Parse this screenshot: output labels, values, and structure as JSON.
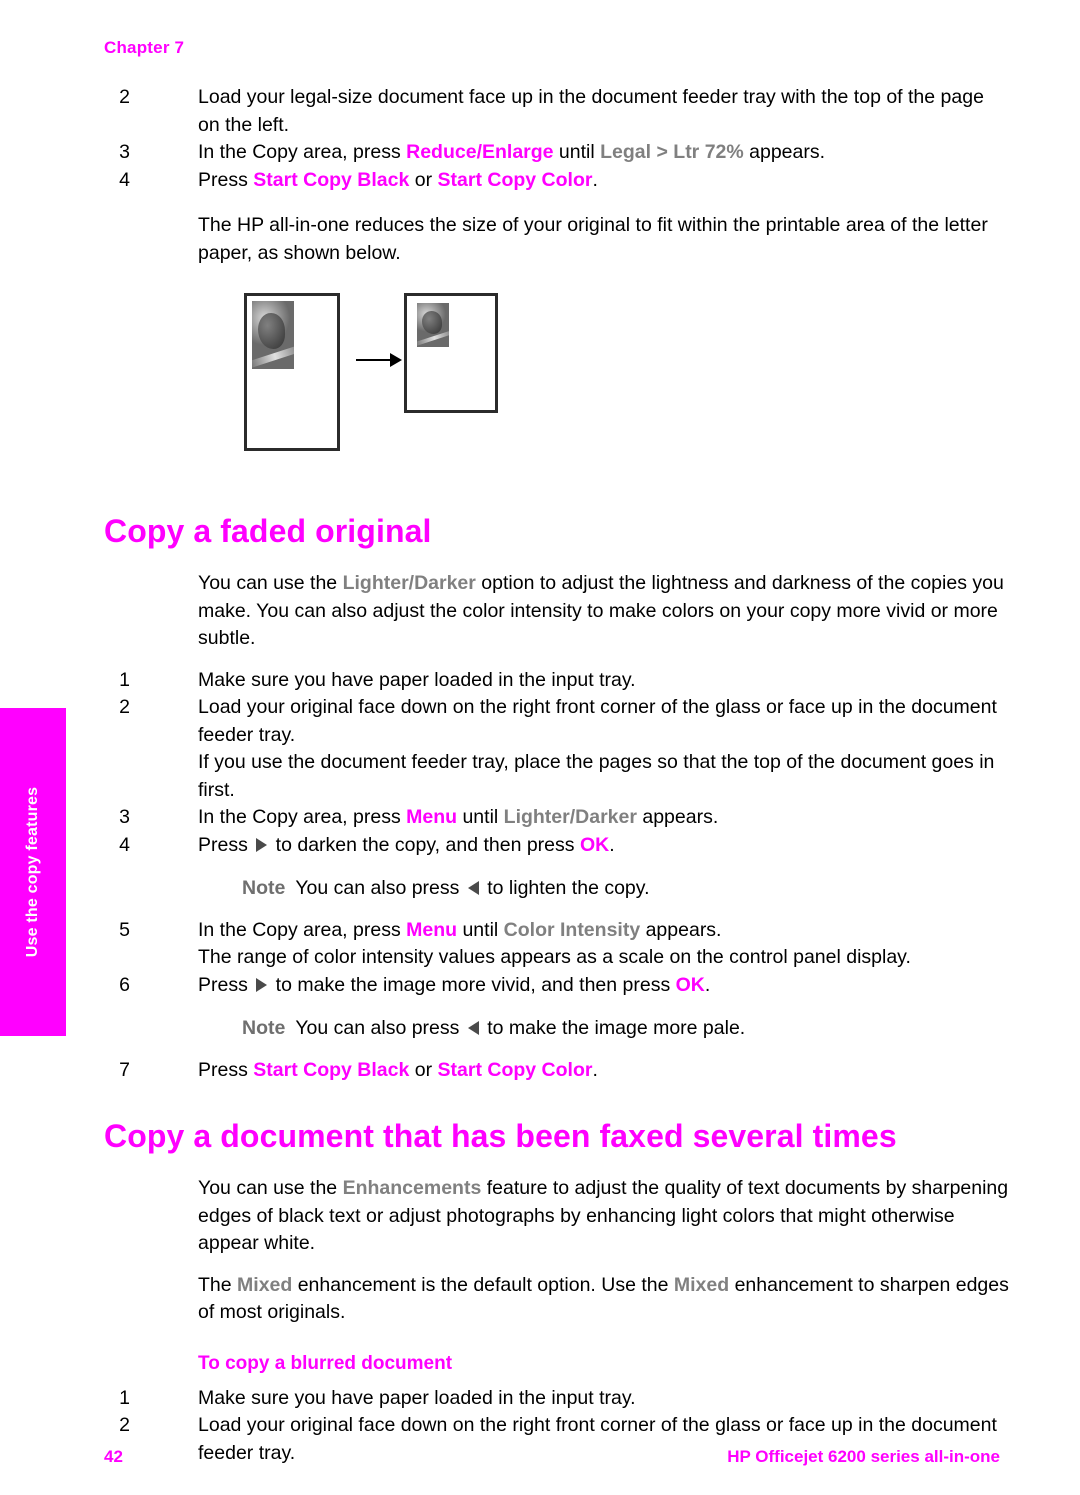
{
  "chapter_label": "Chapter 7",
  "side_tab": {
    "label": "Use the copy features",
    "background": "#ff00ff",
    "text_color": "#ffffff"
  },
  "colors": {
    "accent_magenta": "#ff00ff",
    "ui_term_gray": "#808080",
    "note_gray": "#6f6f6f",
    "body_black": "#000000"
  },
  "top_steps": {
    "step2": {
      "num": "2",
      "text": "Load your legal-size document face up in the document feeder tray with the top of the page on the left."
    },
    "step3": {
      "num": "3",
      "pre": "In the Copy area, press ",
      "button": "Reduce/Enlarge",
      "mid": " until ",
      "ui": "Legal > Ltr 72%",
      "post": " appears."
    },
    "step4": {
      "num": "4",
      "pre": "Press ",
      "button_black": "Start Copy Black",
      "mid": " or ",
      "button_color": "Start Copy Color",
      "post": "."
    }
  },
  "result_paragraph": "The HP all-in-one reduces the size of your original to fit within the printable area of the letter paper, as shown below.",
  "figure": {
    "name": "legal-to-letter-reduction-illustration",
    "source_page_alt": "Legal-size original page with photo and text",
    "result_page_alt": "Letter-size reduced copy with photo and text",
    "arrow_alt": "reduces to"
  },
  "section1": {
    "heading": "Copy a faded original",
    "intro": {
      "pre": "You can use the ",
      "ui": "Lighter/Darker",
      "post": " option to adjust the lightness and darkness of the copies you make. You can also adjust the color intensity to make colors on your copy more vivid or more subtle."
    },
    "steps": {
      "s1": {
        "num": "1",
        "text": "Make sure you have paper loaded in the input tray."
      },
      "s2": {
        "num": "2",
        "text": "Load your original face down on the right front corner of the glass or face up in the document feeder tray.",
        "extra": "If you use the document feeder tray, place the pages so that the top of the document goes in first."
      },
      "s3": {
        "num": "3",
        "pre": "In the Copy area, press ",
        "button": "Menu",
        "mid": " until ",
        "ui": "Lighter/Darker",
        "post": " appears."
      },
      "s4": {
        "num": "4",
        "pre": "Press ",
        "mid": " to darken the copy, and then press ",
        "button": "OK",
        "post": "."
      },
      "note1": {
        "label": "Note",
        "pre": "You can also press ",
        "post": " to lighten the copy."
      },
      "s5": {
        "num": "5",
        "pre": "In the Copy area, press ",
        "button": "Menu",
        "mid": " until ",
        "ui": "Color Intensity",
        "post": " appears.",
        "extra": "The range of color intensity values appears as a scale on the control panel display."
      },
      "s6": {
        "num": "6",
        "pre": "Press ",
        "mid": " to make the image more vivid, and then press ",
        "button": "OK",
        "post": "."
      },
      "note2": {
        "label": "Note",
        "pre": "You can also press ",
        "post": " to make the image more pale."
      },
      "s7": {
        "num": "7",
        "pre": "Press ",
        "button_black": "Start Copy Black",
        "mid": " or ",
        "button_color": "Start Copy Color",
        "post": "."
      }
    }
  },
  "section2": {
    "heading": "Copy a document that has been faxed several times",
    "intro": {
      "pre": "You can use the ",
      "ui": "Enhancements",
      "post": " feature to adjust the quality of text documents by sharpening edges of black text or adjust photographs by enhancing light colors that might otherwise appear white."
    },
    "default_note": {
      "pre": "The ",
      "ui1": "Mixed",
      "mid": " enhancement is the default option. Use the ",
      "ui2": "Mixed",
      "post": " enhancement to sharpen edges of most originals."
    },
    "subheading": "To copy a blurred document",
    "steps": {
      "s1": {
        "num": "1",
        "text": "Make sure you have paper loaded in the input tray."
      },
      "s2": {
        "num": "2",
        "text": "Load your original face down on the right front corner of the glass or face up in the document feeder tray."
      }
    }
  },
  "footer": {
    "page_number": "42",
    "product": "HP Officejet 6200 series all-in-one"
  }
}
